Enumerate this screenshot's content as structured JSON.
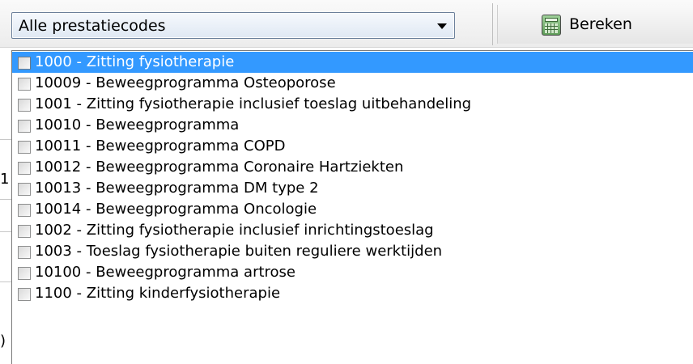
{
  "filter": {
    "selected_value": "Alle prestatiecodes"
  },
  "toolbar": {
    "calculate_label": "Bereken"
  },
  "background_fragments": [
    "1",
    ")"
  ],
  "dropdown": {
    "items": [
      {
        "label": "1000 - Zitting fysiotherapie",
        "selected": true
      },
      {
        "label": "10009 - Beweegprogramma Osteoporose",
        "selected": false
      },
      {
        "label": "1001 - Zitting fysiotherapie inclusief toeslag uitbehandeling",
        "selected": false
      },
      {
        "label": "10010 - Beweegprogramma",
        "selected": false
      },
      {
        "label": "10011 - Beweegprogramma COPD",
        "selected": false
      },
      {
        "label": "10012 - Beweegprogramma Coronaire Hartziekten",
        "selected": false
      },
      {
        "label": "10013 - Beweegprogramma DM type 2",
        "selected": false
      },
      {
        "label": "10014 - Beweegprogramma Oncologie",
        "selected": false
      },
      {
        "label": "1002 - Zitting fysiotherapie inclusief inrichtingstoeslag",
        "selected": false
      },
      {
        "label": "1003 - Toeslag fysiotherapie buiten reguliere werktijden",
        "selected": false
      },
      {
        "label": "10100 - Beweegprogramma artrose",
        "selected": false
      },
      {
        "label": "1100 - Zitting kinderfysiotherapie",
        "selected": false
      }
    ]
  },
  "colors": {
    "selection_highlight": "#3399ff",
    "selected_text": "#ffffff"
  }
}
